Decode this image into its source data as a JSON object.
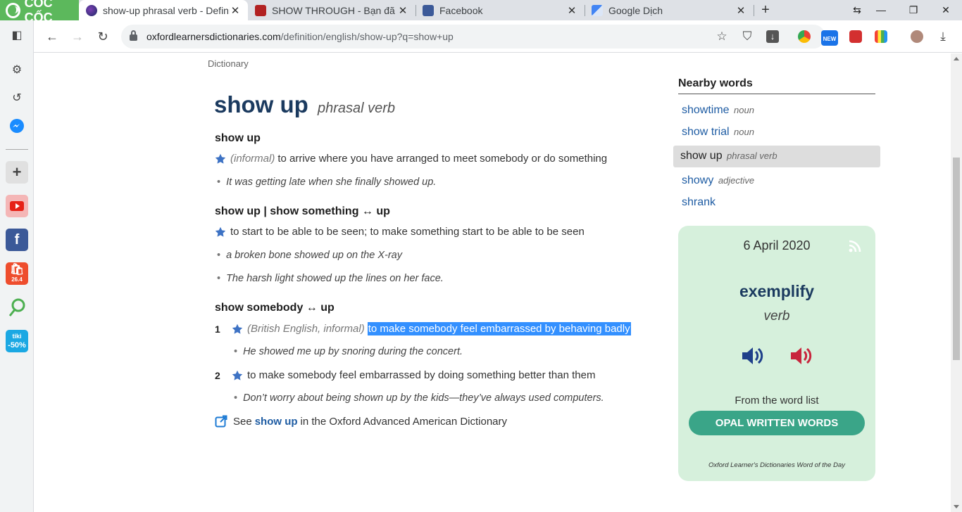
{
  "browser": {
    "brand": "CỐC CỐC",
    "tabs": [
      {
        "title": "show-up phrasal verb - Defini",
        "active": true
      },
      {
        "title": "SHOW THROUGH - Bạn đã đa"
      },
      {
        "title": "Facebook"
      },
      {
        "title": "Google Dịch"
      }
    ],
    "url_domain": "oxfordlearnersdictionaries.com",
    "url_path": "/definition/english/show-up?q=show+up",
    "ext_badge": "NEW"
  },
  "sidebar_apps": {
    "shopee_badge": "26.4",
    "tiki_top": "tiki",
    "tiki_bottom": "-50%"
  },
  "entry": {
    "breadcrumb": "Dictionary",
    "headword": "show up",
    "pos": "phrasal verb",
    "senses": [
      {
        "heading": "show up",
        "label": "(informal)",
        "definition": "to arrive where you have arranged to meet somebody or do something",
        "examples": [
          "It was getting late when she finally showed up."
        ]
      },
      {
        "heading": "show up | show something ↔ up",
        "definition": "to start to be able to be seen; to make something start to be able to be seen",
        "examples": [
          "a broken bone showed up on the X-ray",
          "The harsh light showed up the lines on her face."
        ]
      },
      {
        "heading": "show somebody ↔ up",
        "subs": [
          {
            "num": "1",
            "label": "(British English, informal)",
            "definition": "to make somebody feel embarrassed by behaving badly",
            "example": "He showed me up by snoring during the concert."
          },
          {
            "num": "2",
            "definition": "to make somebody feel embarrassed by doing something better than them",
            "example": "Don’t worry about being shown up by the kids—they’ve always used computers."
          }
        ]
      }
    ],
    "see_also": {
      "prefix": "See",
      "link": "show up",
      "suffix": "in the Oxford Advanced American Dictionary"
    }
  },
  "nearby": {
    "title": "Nearby words",
    "items": [
      {
        "word": "showtime",
        "pos": "noun"
      },
      {
        "word": "show trial",
        "pos": "noun"
      },
      {
        "word": "show up",
        "pos": "phrasal verb",
        "selected": true
      },
      {
        "word": "showy",
        "pos": "adjective"
      },
      {
        "word": "shrank",
        "pos": ""
      }
    ]
  },
  "wotd": {
    "date": "6 April 2020",
    "word": "exemplify",
    "pos": "verb",
    "from_label": "From the word list",
    "button": "OPAL WRITTEN WORDS",
    "footer": "Oxford Learner's Dictionaries Word of the Day"
  },
  "colors": {
    "accent_blue": "#1e5ca3",
    "headword": "#1b3a5f",
    "wotd_bg": "#d6f0dc",
    "wotd_button": "#3aa588",
    "selection": "#3390ff"
  }
}
